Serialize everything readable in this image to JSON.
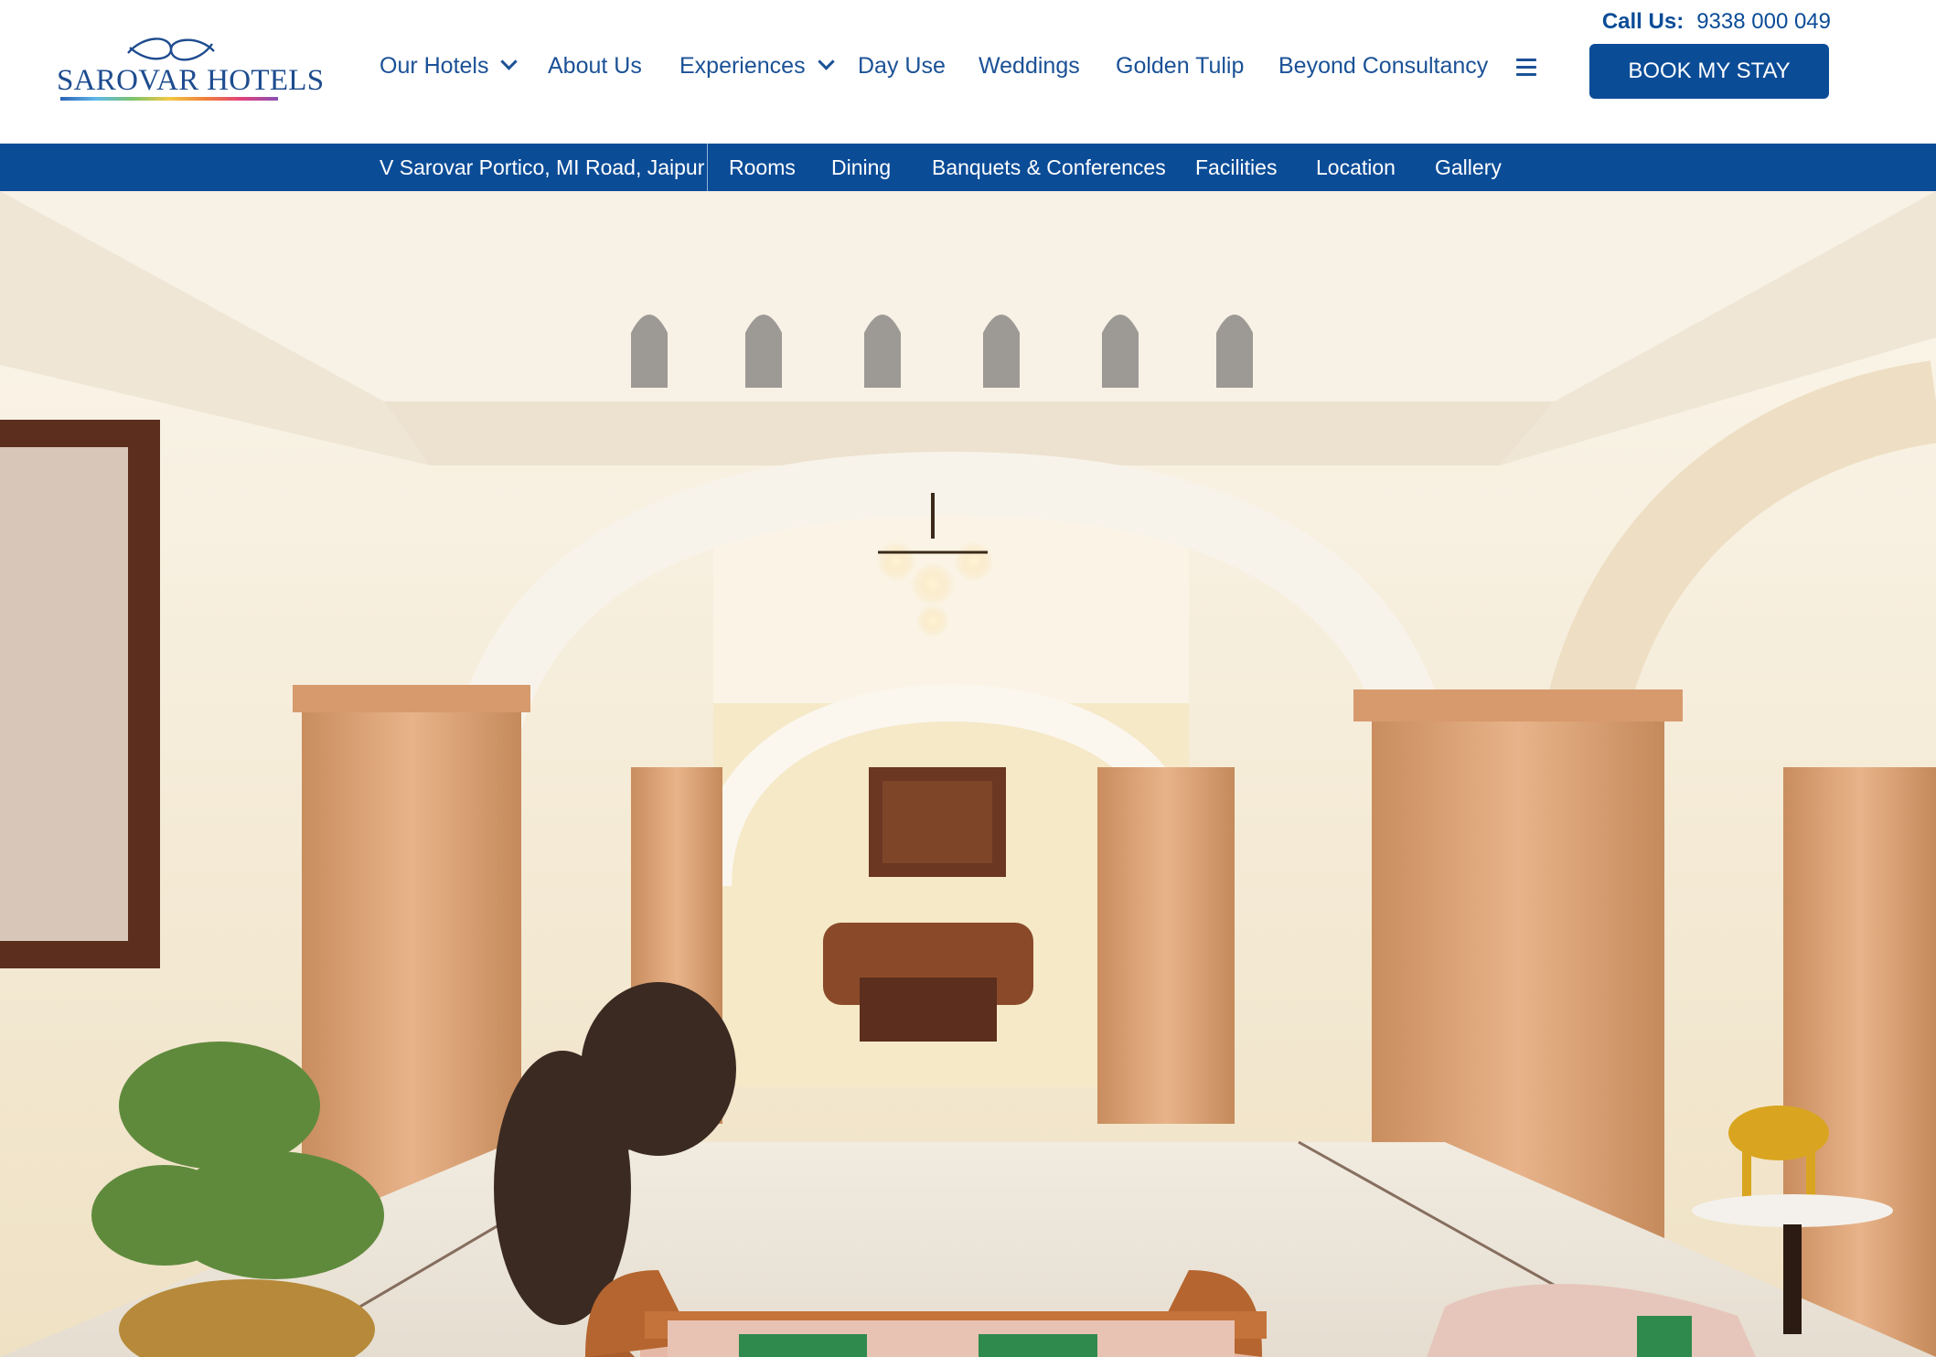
{
  "brand": {
    "logo_text": "SAROVAR HOTELS"
  },
  "contact": {
    "label": "Call Us:",
    "phone": "9338 000 049"
  },
  "main_nav": {
    "our_hotels": "Our Hotels",
    "about_us": "About Us",
    "experiences": "Experiences",
    "day_use": "Day Use",
    "weddings": "Weddings",
    "golden_tulip": "Golden Tulip",
    "beyond_consultancy": "Beyond Consultancy",
    "menu_icon": "hamburger-icon",
    "dropdown_icon": "chevron-down-icon"
  },
  "cta": {
    "book_label": "BOOK MY STAY"
  },
  "sub_nav": {
    "property": "V Sarovar Portico, MI Road, Jaipur",
    "rooms": "Rooms",
    "dining": "Dining",
    "banquets": "Banquets & Conferences",
    "facilities": "Facilities",
    "location": "Location",
    "gallery": "Gallery"
  },
  "colors": {
    "brand_blue": "#0b4c97",
    "nav_text": "#1b5196",
    "white": "#ffffff"
  }
}
